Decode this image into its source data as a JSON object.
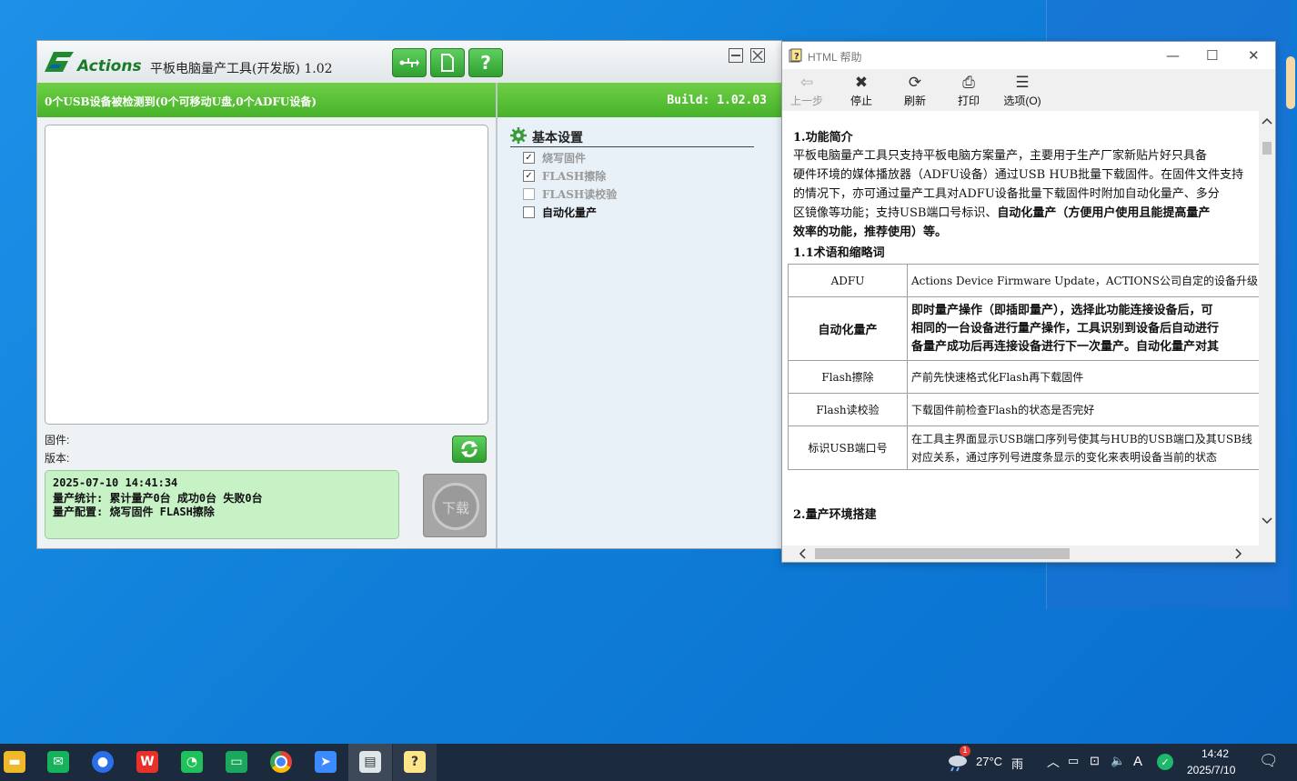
{
  "tool": {
    "logo_text": "Actions",
    "title": "平板电脑量产工具(开发版) 1.02",
    "toolbar_buttons": [
      "usb-icon",
      "document-icon",
      "help-icon"
    ],
    "toolbar_help_glyph": "?",
    "status_left": "0个USB设备被检测到(0个可移动U盘,0个ADFU设备)",
    "status_right": "Build: 1.02.03",
    "firmware_label": "固件:",
    "version_label": "版本:",
    "info_lines": [
      "2025-07-10 14:41:34",
      "量产统计: 累计量产0台 成功0台 失败0台",
      "量产配置: 烧写固件 FLASH擦除"
    ],
    "download_label": "下载",
    "settings_title": "基本设置",
    "options": [
      {
        "label": "烧写固件",
        "checked": true,
        "enabled": false
      },
      {
        "label": "FLASH擦除",
        "checked": true,
        "enabled": false
      },
      {
        "label": "FLASH读校验",
        "checked": false,
        "enabled": false
      },
      {
        "label": "自动化量产",
        "checked": false,
        "enabled": true
      }
    ]
  },
  "help": {
    "window_title": "HTML 帮助",
    "toolbar": [
      {
        "label": "上一步",
        "icon": "back-arrow-icon",
        "glyph": "⇦",
        "enabled": false
      },
      {
        "label": "停止",
        "icon": "stop-icon",
        "glyph": "✖",
        "enabled": true
      },
      {
        "label": "刷新",
        "icon": "refresh-icon",
        "glyph": "⟳",
        "enabled": true
      },
      {
        "label": "打印",
        "icon": "print-icon",
        "glyph": "⎙",
        "enabled": true
      },
      {
        "label": "选项(O)",
        "icon": "options-icon",
        "glyph": "☰",
        "enabled": true
      }
    ],
    "section1_title": "1.功能简介",
    "section1_lines": [
      "平板电脑量产工具只支持平板电脑方案量产，主要用于生产厂家新贴片好只具备",
      "硬件环境的媒体播放器（ADFU设备）通过USB HUB批量下载固件。在固件文件支持",
      "的情况下，亦可通过量产工具对ADFU设备批量下载固件时附加自动化量产、多分",
      "区镜像等功能；支持USB端口号标识、",
      "自动化量产（方便用户使用且能提高量产",
      "效率的功能，推荐使用）等。"
    ],
    "section11_title": "1.1术语和缩略词",
    "terms": [
      {
        "term": "ADFU",
        "desc": [
          "Actions Device Firmware Update，ACTIONS公司自定的设备升级"
        ]
      },
      {
        "term": "自动化量产",
        "desc": [
          "即时量产操作（即插即量产），选择此功能连接设备后，可",
          "相同的一台设备进行量产操作，工具识别到设备后自动进行",
          "备量产成功后再连接设备进行下一次量产。自动化量产对其"
        ]
      },
      {
        "term": "Flash擦除",
        "desc": [
          "产前先快速格式化Flash再下载固件"
        ]
      },
      {
        "term": "Flash读校验",
        "desc": [
          "下载固件前检查Flash的状态是否完好"
        ]
      },
      {
        "term": "标识USB端口号",
        "desc": [
          "在工具主界面显示USB端口序列号使其与HUB的USB端口及其USB线",
          "对应关系，通过序列号进度条显示的变化来表明设备当前的状态"
        ]
      }
    ],
    "section2_title": "2.量产环境搭建"
  },
  "taskbar": {
    "weather_temp": "27°C",
    "weather_text": "雨",
    "weather_badge": "1",
    "ime": "A",
    "time": "14:42",
    "date": "2025/7/10",
    "apps": [
      "file-explorer-icon",
      "messaging-icon",
      "browser-icon",
      "wps-icon",
      "wechat-icon",
      "chat-icon",
      "chrome-icon",
      "feishu-icon",
      "production-tool-icon",
      "html-help-icon"
    ]
  },
  "colors": {
    "accent_green": "#46b22a",
    "info_bg": "#c6f2c6",
    "desktop": "#1e90e8"
  }
}
